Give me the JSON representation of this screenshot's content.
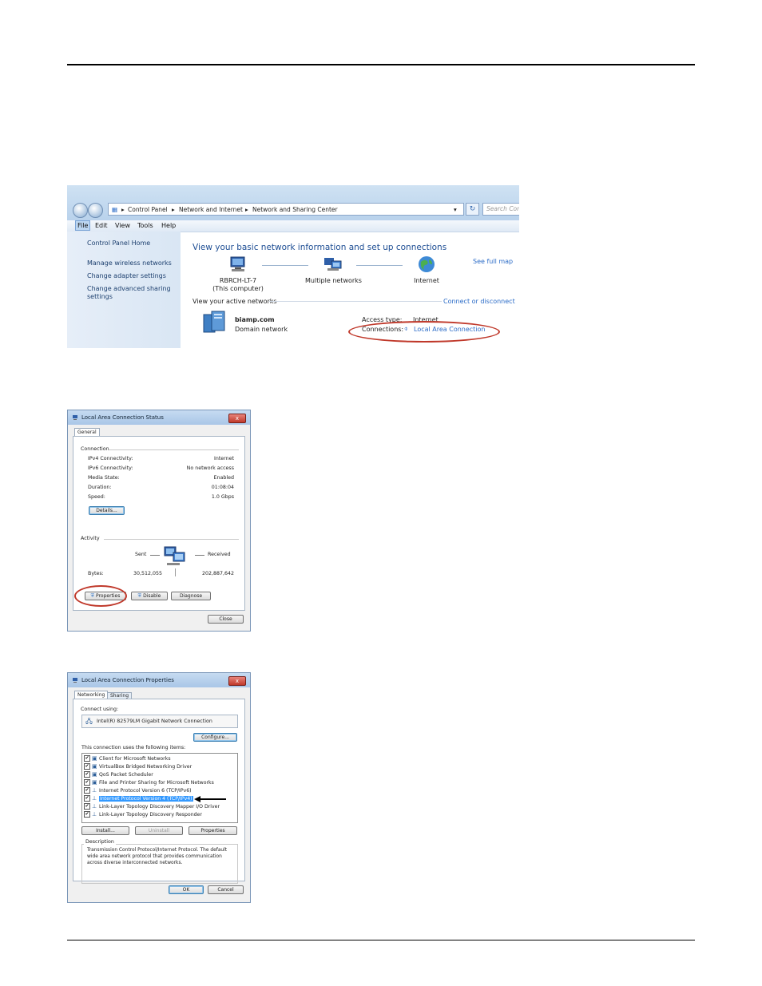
{
  "network_center": {
    "address": [
      "Control Panel",
      "Network and Internet",
      "Network and Sharing Center"
    ],
    "search_placeholder": "Search Con",
    "menu": [
      "File",
      "Edit",
      "View",
      "Tools",
      "Help"
    ],
    "sidebar": {
      "home": "Control Panel Home",
      "links": [
        "Manage wireless networks",
        "Change adapter settings",
        "Change advanced sharing",
        "settings"
      ]
    },
    "heading": "View your basic network information and set up connections",
    "see_full_map": "See full map",
    "map": {
      "computer": "RBRCH-LT-7",
      "computer_sub": "(This computer)",
      "networks": "Multiple networks",
      "internet": "Internet"
    },
    "active_networks_label": "View your active networks",
    "connect_disconnect": "Connect or disconnect",
    "network_name": "biamp.com",
    "network_type": "Domain network",
    "access_type_label": "Access type:",
    "access_type_value": "Internet",
    "connections_label": "Connections:",
    "connections_value": "Local Area Connection",
    "colors": {
      "link": "#2a6bc7",
      "heading": "#1e4e94",
      "highlight_oval": "#c0392b"
    }
  },
  "status_dialog": {
    "title": "Local Area Connection Status",
    "close_x": "x",
    "tab": "General",
    "connection_group": "Connection",
    "rows": [
      {
        "label": "IPv4 Connectivity:",
        "value": "Internet"
      },
      {
        "label": "IPv6 Connectivity:",
        "value": "No network access"
      },
      {
        "label": "Media State:",
        "value": "Enabled"
      },
      {
        "label": "Duration:",
        "value": "01:08:04"
      },
      {
        "label": "Speed:",
        "value": "1.0 Gbps"
      }
    ],
    "details_button": "Details...",
    "activity_group": "Activity",
    "sent_label": "Sent",
    "received_label": "Received",
    "bytes_label": "Bytes:",
    "bytes_sent": "30,512,055",
    "bytes_received": "202,887,642",
    "properties_button": "Properties",
    "disable_button": "Disable",
    "diagnose_button": "Diagnose",
    "close_button": "Close"
  },
  "properties_dialog": {
    "title": "Local Area Connection Properties",
    "close_x": "x",
    "tabs": [
      "Networking",
      "Sharing"
    ],
    "connect_using_label": "Connect using:",
    "adapter": "Intel(R) 82579LM Gigabit Network Connection",
    "configure_button": "Configure...",
    "items_label": "This connection uses the following items:",
    "items": [
      "Client for Microsoft Networks",
      "VirtualBox Bridged Networking Driver",
      "QoS Packet Scheduler",
      "File and Printer Sharing for Microsoft Networks",
      "Internet Protocol Version 6 (TCP/IPv6)",
      "Internet Protocol Version 4 (TCP/IPv4)",
      "Link-Layer Topology Discovery Mapper I/O Driver",
      "Link-Layer Topology Discovery Responder"
    ],
    "selected_index": 5,
    "install_button": "Install...",
    "uninstall_button": "Uninstall",
    "properties_button": "Properties",
    "description_label": "Description",
    "description_lines": [
      "Transmission Control Protocol/Internet Protocol. The default",
      "wide area network protocol that provides communication",
      "across diverse interconnected networks."
    ],
    "ok_button": "OK",
    "cancel_button": "Cancel"
  }
}
